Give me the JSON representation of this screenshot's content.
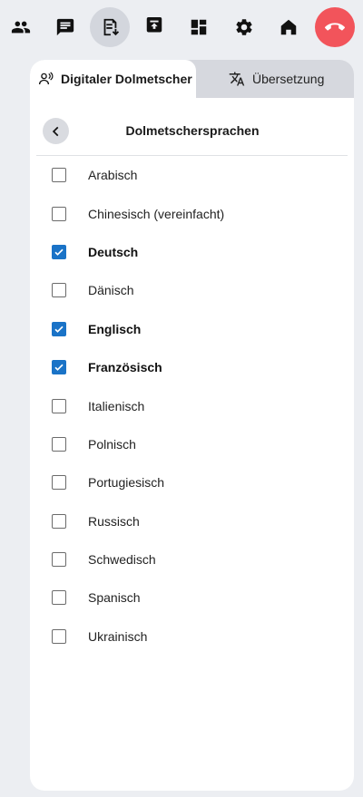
{
  "toolbar": {
    "buttons": [
      {
        "icon": "participants-icon",
        "active": false
      },
      {
        "icon": "chat-icon",
        "active": false
      },
      {
        "icon": "transcript-download-icon",
        "active": true
      },
      {
        "icon": "upload-icon",
        "active": false
      },
      {
        "icon": "apps-grid-icon",
        "active": false
      },
      {
        "icon": "settings-gear-icon",
        "active": false
      },
      {
        "icon": "home-icon",
        "active": false
      },
      {
        "icon": "hang-up-icon",
        "active": false
      }
    ],
    "hangup_color": "#f2545b"
  },
  "tabs": {
    "active_label": "Digitaler Dolmetscher",
    "inactive_label": "Übersetzung"
  },
  "header": {
    "title": "Dolmetschersprachen"
  },
  "languages": [
    {
      "label": "Arabisch",
      "checked": false
    },
    {
      "label": "Chinesisch (vereinfacht)",
      "checked": false
    },
    {
      "label": "Deutsch",
      "checked": true
    },
    {
      "label": "Dänisch",
      "checked": false
    },
    {
      "label": "Englisch",
      "checked": true
    },
    {
      "label": "Französisch",
      "checked": true
    },
    {
      "label": "Italienisch",
      "checked": false
    },
    {
      "label": "Polnisch",
      "checked": false
    },
    {
      "label": "Portugiesisch",
      "checked": false
    },
    {
      "label": "Russisch",
      "checked": false
    },
    {
      "label": "Schwedisch",
      "checked": false
    },
    {
      "label": "Spanisch",
      "checked": false
    },
    {
      "label": "Ukrainisch",
      "checked": false
    }
  ],
  "colors": {
    "checkbox_checked": "#1a73c7",
    "background": "#eceef2"
  }
}
